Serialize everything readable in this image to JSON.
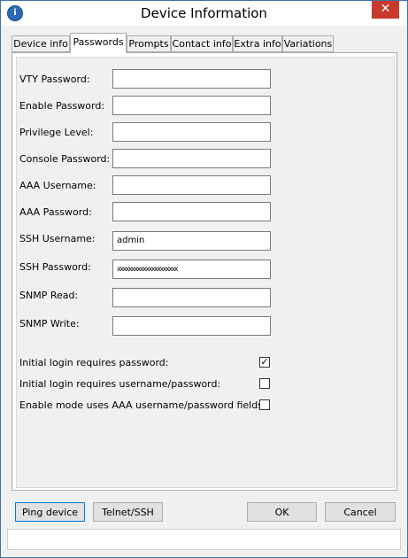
{
  "window": {
    "title": "Device Information",
    "close_glyph": "✕"
  },
  "tabs": [
    {
      "label": "Device info",
      "active": false
    },
    {
      "label": "Passwords",
      "active": true
    },
    {
      "label": "Prompts",
      "active": false
    },
    {
      "label": "Contact info",
      "active": false
    },
    {
      "label": "Extra info",
      "active": false
    },
    {
      "label": "Variations",
      "active": false
    }
  ],
  "fields": [
    {
      "label": "VTY Password:",
      "value": ""
    },
    {
      "label": "Enable Password:",
      "value": ""
    },
    {
      "label": "Privilege Level:",
      "value": ""
    },
    {
      "label": "Console Password:",
      "value": ""
    },
    {
      "label": "AAA Username:",
      "value": ""
    },
    {
      "label": "AAA Password:",
      "value": ""
    },
    {
      "label": "SSH Username:",
      "value": "admin"
    },
    {
      "label": "SSH Password:",
      "value": "xxxxxxxxxxxxxxxxxxxxx"
    },
    {
      "label": "SNMP Read:",
      "value": ""
    },
    {
      "label": "SNMP Write:",
      "value": ""
    }
  ],
  "checkboxes": [
    {
      "label": "Initial login requires password:",
      "checked": true,
      "mark": "✓"
    },
    {
      "label": "Initial login requires username/password:",
      "checked": false,
      "mark": ""
    },
    {
      "label": "Enable mode uses AAA username/password fields:",
      "checked": false,
      "mark": ""
    }
  ],
  "buttons": {
    "ping": "Ping device",
    "telnet": "Telnet/SSH",
    "ok": "OK",
    "cancel": "Cancel"
  },
  "status": {
    "text": ""
  }
}
